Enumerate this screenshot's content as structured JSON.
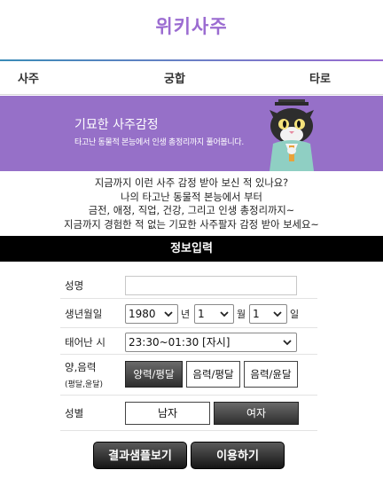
{
  "header": {
    "logo_text": "위키사주"
  },
  "nav": {
    "items": [
      "사주",
      "궁합",
      "타로"
    ]
  },
  "banner": {
    "title": "기묘한 사주감정",
    "subtitle": "타고난 동물적 본능에서 인생 총정리까지 풀어봅니다."
  },
  "intro": {
    "lines": [
      "지금까지 이런 사주 감정 받아 보신 적 있나요?",
      "나의 타고난 동물적 본능에서 부터",
      "금전, 애정, 직업, 건강, 그리고 인생 총정리까지~",
      "지금까지 경험한 적 없는 기묘한 사주팔자 감정 받아 보세요~"
    ]
  },
  "section": {
    "title": "정보입력"
  },
  "form": {
    "name_label": "성명",
    "name_value": "",
    "birth_label": "생년월일",
    "year": "1980",
    "year_unit": "년",
    "month": "1",
    "month_unit": "월",
    "day": "1",
    "day_unit": "일",
    "time_label": "태어난 시",
    "time_value": "23:30~01:30 [자시]",
    "calendar_label": "양,음력",
    "calendar_sub": "(평달,윤달)",
    "calendar_options": [
      "양력/평달",
      "음력/평달",
      "음력/윤달"
    ],
    "gender_label": "성별",
    "gender_options": [
      "남자",
      "여자"
    ]
  },
  "actions": {
    "sample_label": "결과샘플보기",
    "use_label": "이용하기"
  },
  "colors": {
    "brand_purple": "#9b6cd1",
    "banner": "#9670c8",
    "nav_accent": "#3a8bb7"
  }
}
